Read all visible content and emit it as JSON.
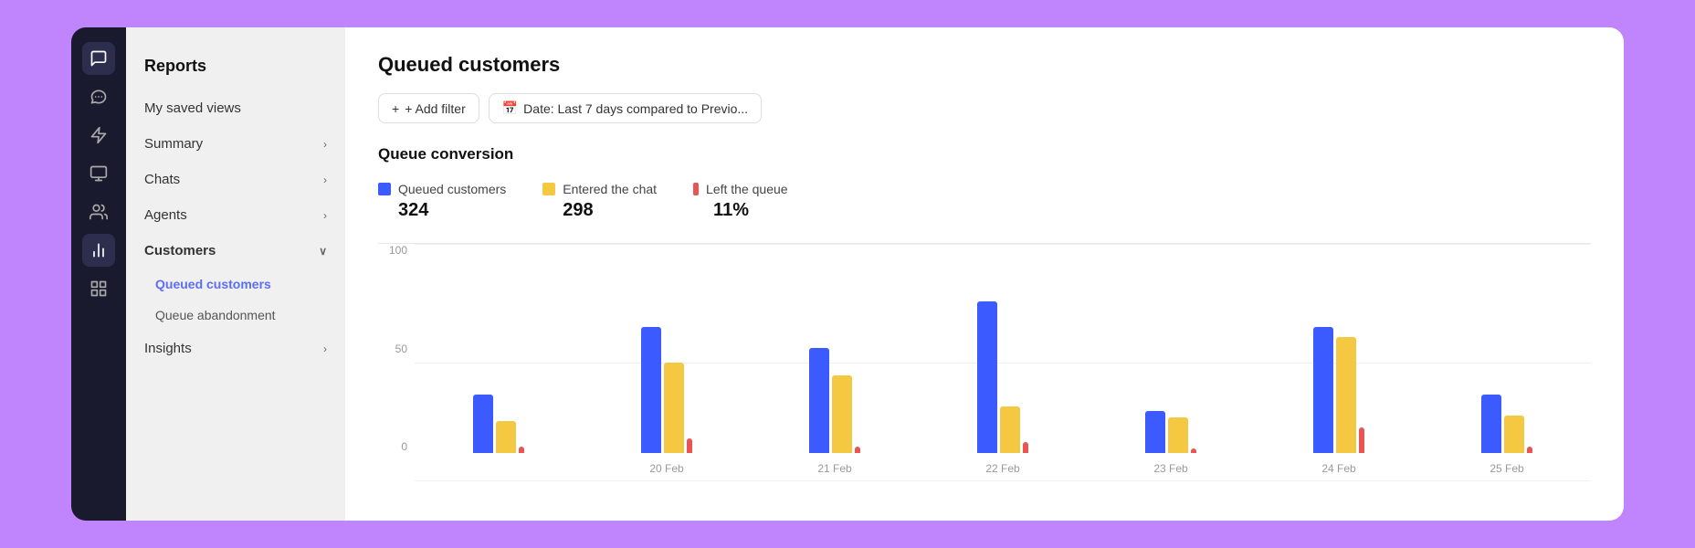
{
  "background_color": "#c084fc",
  "iconbar": {
    "icons": [
      {
        "name": "chat-bubble-icon",
        "symbol": "💬",
        "active": false
      },
      {
        "name": "lightning-icon",
        "symbol": "⚡",
        "active": false
      },
      {
        "name": "inbox-icon",
        "symbol": "▦",
        "active": false
      },
      {
        "name": "users-icon",
        "symbol": "👥",
        "active": false
      },
      {
        "name": "chart-icon",
        "symbol": "📊",
        "active": true
      },
      {
        "name": "grid-icon",
        "symbol": "⊞",
        "active": false
      }
    ]
  },
  "sidebar": {
    "section_title": "Reports",
    "items": [
      {
        "label": "My saved views",
        "has_chevron": false,
        "active": false
      },
      {
        "label": "Summary",
        "has_chevron": true,
        "active": false
      },
      {
        "label": "Chats",
        "has_chevron": true,
        "active": false
      },
      {
        "label": "Agents",
        "has_chevron": true,
        "active": false
      },
      {
        "label": "Customers",
        "has_chevron": true,
        "active": true,
        "expanded": true
      },
      {
        "label": "Insights",
        "has_chevron": true,
        "active": false
      }
    ],
    "sub_items": [
      {
        "label": "Queued customers",
        "active": true
      },
      {
        "label": "Queue abandonment",
        "active": false
      }
    ]
  },
  "main": {
    "title": "Queued customers",
    "filters": [
      {
        "label": "+ Add filter",
        "icon": ""
      },
      {
        "label": "Date: Last 7 days compared to Previo...",
        "icon": "📅"
      }
    ],
    "chart_section": {
      "title": "Queue conversion",
      "legend": [
        {
          "label": "Queued customers",
          "value": "324",
          "color": "#3b5bff"
        },
        {
          "label": "Entered the chat",
          "value": "298",
          "color": "#f5c842"
        },
        {
          "label": "Left the queue",
          "value": "11%",
          "color": "#e85555"
        }
      ],
      "y_labels": [
        "100",
        "50",
        "0"
      ],
      "x_labels": [
        "20 Feb",
        "21 Feb",
        "22 Feb",
        "23 Feb",
        "24 Feb",
        "25 Feb"
      ],
      "bars": [
        {
          "blue": 28,
          "yellow": 15,
          "red": 3
        },
        {
          "blue": 60,
          "yellow": 43,
          "red": 7
        },
        {
          "blue": 50,
          "yellow": 37,
          "red": 3
        },
        {
          "blue": 72,
          "yellow": 22,
          "red": 5
        },
        {
          "blue": 20,
          "yellow": 17,
          "red": 2
        },
        {
          "blue": 60,
          "yellow": 55,
          "red": 12
        },
        {
          "blue": 28,
          "yellow": 18,
          "red": 3
        }
      ]
    }
  }
}
